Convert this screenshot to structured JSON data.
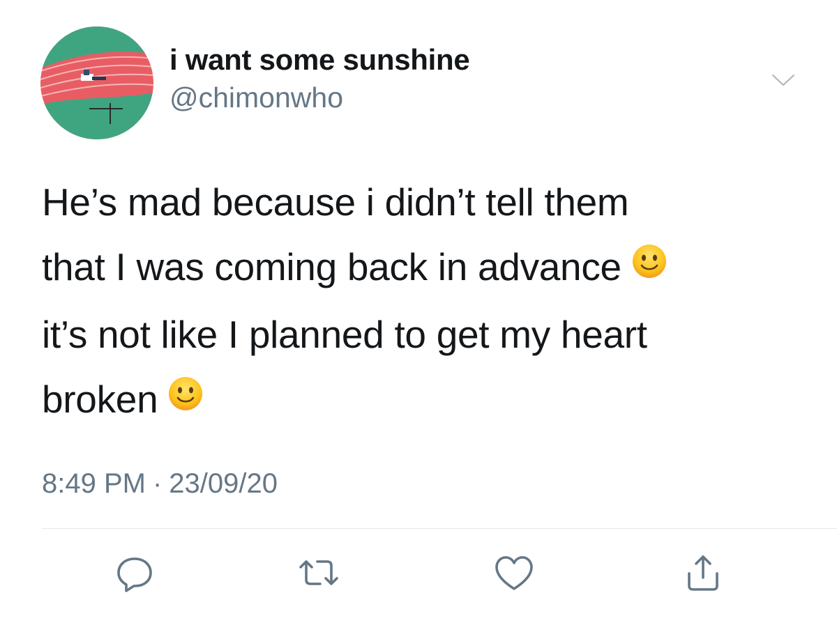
{
  "author": {
    "display_name": "i want some sunshine",
    "handle": "@chimonwho"
  },
  "tweet": {
    "lines": [
      "He’s mad because i didn’t tell them",
      "that I was coming back in advance",
      "it’s not like I planned to get my heart",
      "broken"
    ],
    "emoji": "slightly-smiling-face"
  },
  "meta": {
    "time": "8:49 PM",
    "separator": "·",
    "date": "23/09/20"
  },
  "actions": {
    "reply_icon": "reply-icon",
    "retweet_icon": "retweet-icon",
    "like_icon": "heart-icon",
    "share_icon": "share-icon"
  },
  "colors": {
    "text": "#14171a",
    "secondary": "#657786",
    "divider": "#e1e8ed",
    "icon": "#657786"
  }
}
